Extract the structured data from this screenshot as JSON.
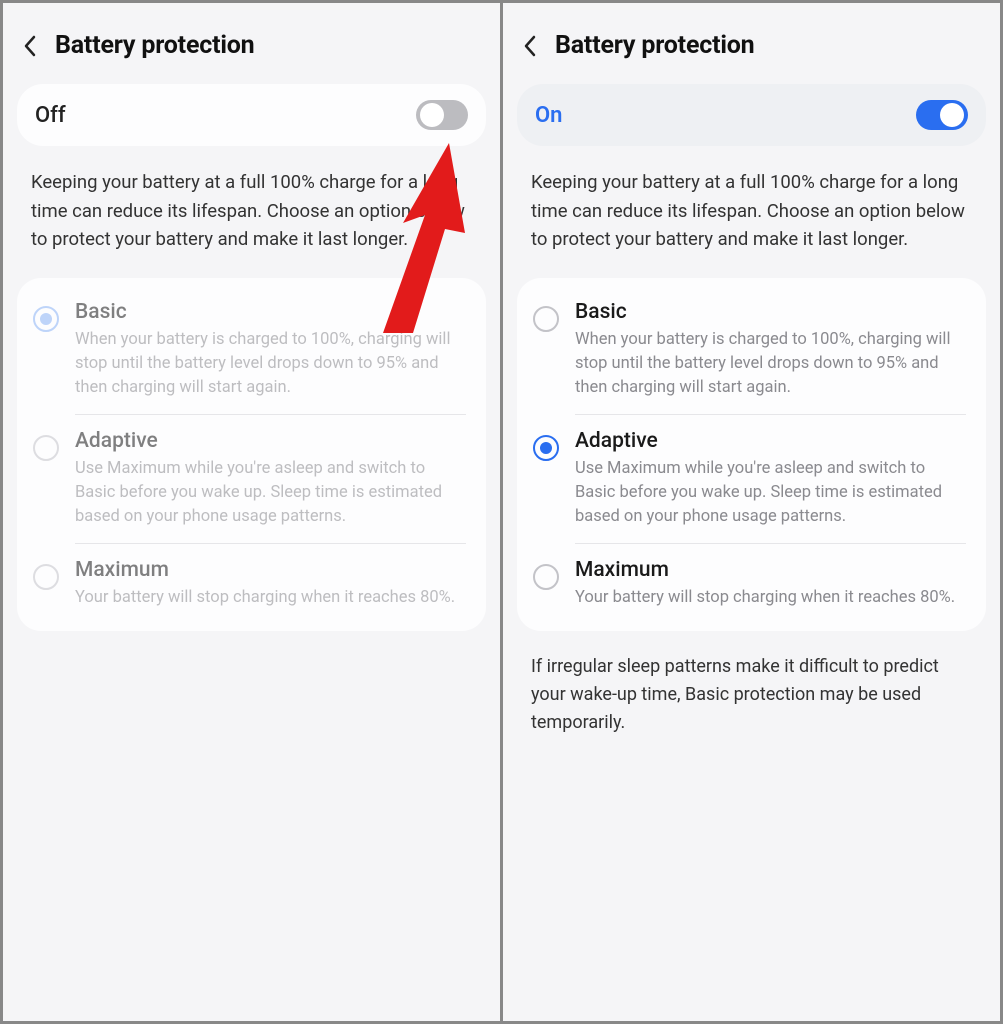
{
  "left": {
    "title": "Battery protection",
    "state_label": "Off",
    "description": "Keeping your battery at a full 100% charge for a long time can reduce its lifespan. Choose an option below to protect your battery and make it last longer.",
    "options": [
      {
        "title": "Basic",
        "sub": "When your battery is charged to 100%, charging will stop until the battery level drops down to 95% and then charging will start again.",
        "selected": true
      },
      {
        "title": "Adaptive",
        "sub": "Use Maximum while you're asleep and switch to Basic before you wake up. Sleep time is estimated based on your phone usage patterns.",
        "selected": false
      },
      {
        "title": "Maximum",
        "sub": "Your battery will stop charging when it reaches 80%.",
        "selected": false
      }
    ]
  },
  "right": {
    "title": "Battery protection",
    "state_label": "On",
    "description": "Keeping your battery at a full 100% charge for a long time can reduce its lifespan. Choose an option below to protect your battery and make it last longer.",
    "options": [
      {
        "title": "Basic",
        "sub": "When your battery is charged to 100%, charging will stop until the battery level drops down to 95% and then charging will start again.",
        "selected": false
      },
      {
        "title": "Adaptive",
        "sub": "Use Maximum while you're asleep and switch to Basic before you wake up. Sleep time is estimated based on your phone usage patterns.",
        "selected": true
      },
      {
        "title": "Maximum",
        "sub": "Your battery will stop charging when it reaches 80%.",
        "selected": false
      }
    ],
    "footnote": "If irregular sleep patterns make it difficult to predict your wake-up time, Basic protection may be used temporarily."
  }
}
